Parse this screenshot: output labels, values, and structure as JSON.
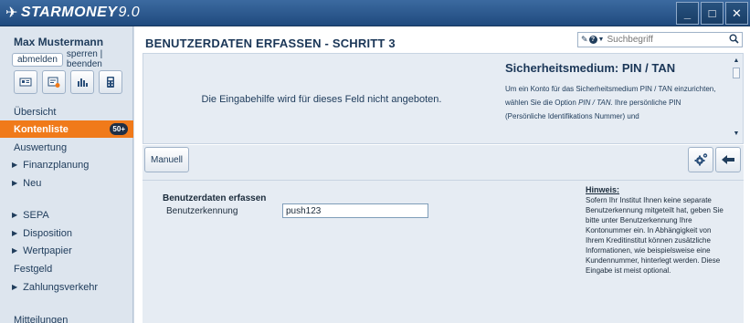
{
  "window": {
    "logo_brand": "STARMONEY",
    "logo_version": "9.0",
    "minimize_label": "_",
    "maximize_label": "□",
    "close_label": "✕"
  },
  "sidebar": {
    "username": "Max Mustermann",
    "logout_label": "abmelden",
    "lock_quit_label": "sperren | beenden",
    "tool_icons": [
      "address-card-icon",
      "transfer-form-icon",
      "bar-chart-icon",
      "calculator-icon"
    ],
    "nav": [
      {
        "label": "Übersicht",
        "arrow": ""
      },
      {
        "label": "Kontenliste",
        "arrow": "",
        "active": true,
        "badge": "50+"
      },
      {
        "label": "Auswertung",
        "arrow": ""
      },
      {
        "label": "Finanzplanung",
        "arrow": "▶"
      },
      {
        "label": "Neu",
        "arrow": "▶"
      },
      {
        "label": "SEPA",
        "arrow": "▶"
      },
      {
        "label": "Disposition",
        "arrow": "▶"
      },
      {
        "label": "Wertpapier",
        "arrow": "▶"
      },
      {
        "label": "Festgeld",
        "arrow": ""
      },
      {
        "label": "Zahlungsverkehr",
        "arrow": "▶"
      },
      {
        "label": "Mitteilungen",
        "arrow": ""
      }
    ]
  },
  "main": {
    "title": "BENUTZERDATEN ERFASSEN - SCHRITT 3",
    "search_placeholder": "Suchbegriff",
    "help_center_text": "Die Eingabehilfe wird für dieses Feld nicht angeboten.",
    "help_title": "Sicherheitsmedium: PIN / TAN",
    "help_text_1": "Um ein Konto für das Sicherheitsmedium PIN / TAN einzurichten, wählen Sie die Option ",
    "help_text_em": "PIN / TAN",
    "help_text_2": ". Ihre persönliche PIN (Persönliche Identifikations Nummer) und",
    "manual_button": "Manuell",
    "form_heading": "Benutzerdaten erfassen",
    "form_label": "Benutzerkennung",
    "form_value": "push123",
    "hint_title": "Hinweis:",
    "hint_text": "Sofern Ihr Institut Ihnen keine separate Benutzerkennung mitgeteilt hat, geben Sie bitte unter Benutzerkennung Ihre Kontonummer ein. In Abhängigkeit von Ihrem Kreditinstitut können zusätzliche Informationen, wie beispielsweise eine Kundennummer, hinterlegt werden. Diese Eingabe ist meist optional."
  },
  "colors": {
    "titlebar": "#2a5a8f",
    "accent": "#f07a1a",
    "panel": "#e6ecf3"
  }
}
